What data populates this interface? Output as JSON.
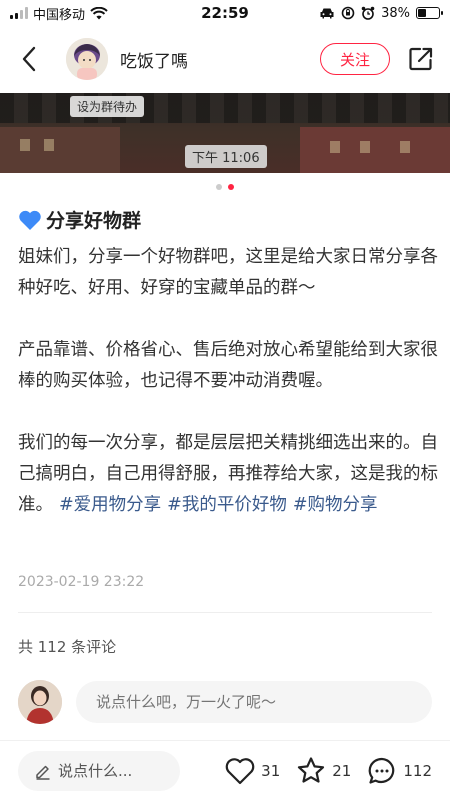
{
  "status_bar": {
    "carrier": "中国移动",
    "time": "22:59",
    "battery": "38%",
    "battery_level": 0.38,
    "icons": [
      "signal-icon",
      "wifi-icon",
      "car-icon",
      "rotation-lock-icon",
      "alarm-icon",
      "battery-icon"
    ]
  },
  "header": {
    "back_icon": "back-arrow-icon",
    "author_name": "吃饭了嗎",
    "follow_label": "关注",
    "share_icon": "share-icon",
    "accent_color": "#ff2442"
  },
  "image": {
    "group_chip": "设为群待办",
    "time_chip": "下午 11:06",
    "page_count": 2,
    "current_page": 2
  },
  "post": {
    "title_emoji": "blue-heart-icon",
    "title": "分享好物群",
    "paragraphs": [
      "姐妹们，分享一个好物群吧，这里是给大家日常分享各种好吃、好用、好穿的宝藏单品的群～",
      "产品靠谱、价格省心、售后绝对放心希望能给到大家很棒的购买体验，也记得不要冲动消费喔。",
      "我们的每一次分享，都是层层把关精挑细选出来的。自己搞明白，自己用得舒服，再推荐给大家，这是我的标准。"
    ],
    "tags": [
      "#爱用物分享",
      "#我的平价好物",
      "#购物分享"
    ],
    "tag_color": "#3a5a8c",
    "date": "2023-02-19 23:22"
  },
  "comments": {
    "count_text": "共 112 条评论",
    "input_placeholder": "说点什么吧，万一火了呢～"
  },
  "bottom_bar": {
    "say_label": "说点什么...",
    "likes": "31",
    "stars": "21",
    "comments": "112"
  }
}
